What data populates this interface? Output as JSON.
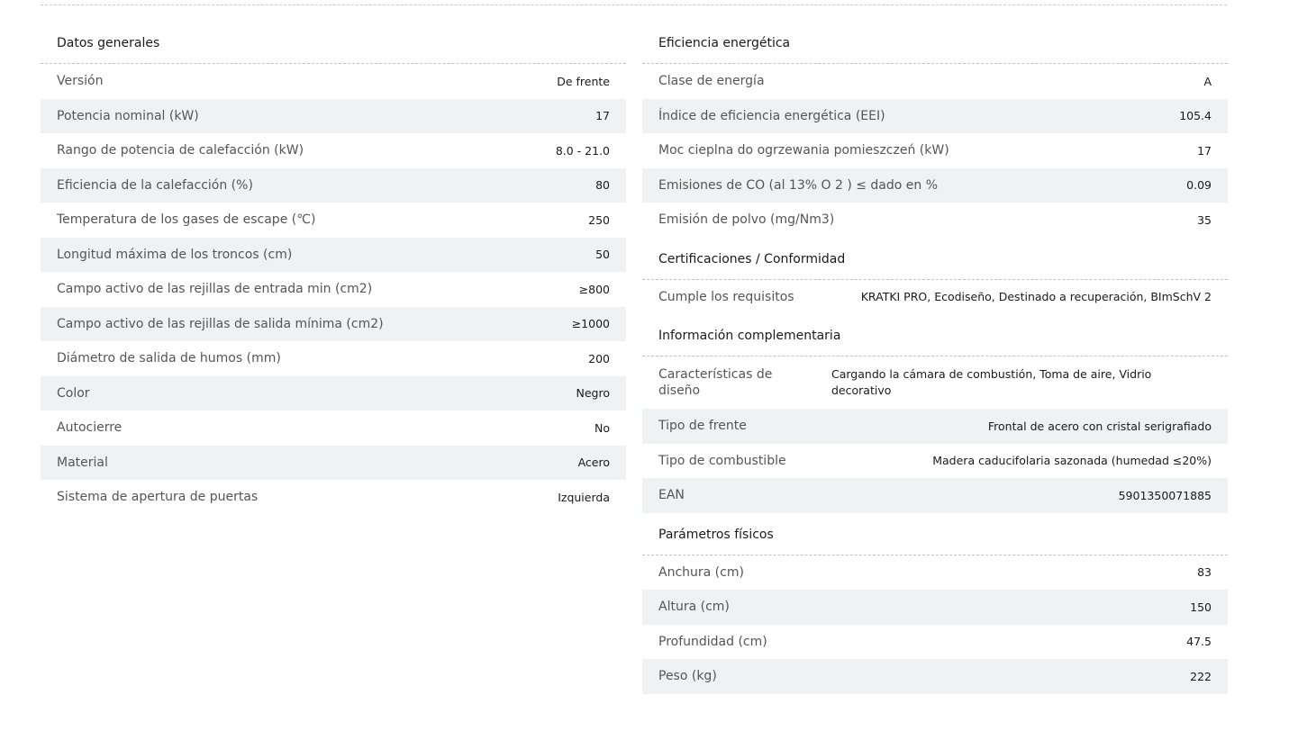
{
  "general": {
    "title": "Datos generales",
    "rows": [
      {
        "label": "Versión",
        "value": "De frente"
      },
      {
        "label": "Potencia nominal (kW)",
        "value": "17"
      },
      {
        "label": "Rango de potencia de calefacción (kW)",
        "value": "8.0 - 21.0"
      },
      {
        "label": "Eficiencia de la calefacción (%)",
        "value": "80"
      },
      {
        "label": "Temperatura de los gases de escape (℃)",
        "value": "250"
      },
      {
        "label": "Longitud máxima de los troncos (cm)",
        "value": "50"
      },
      {
        "label": "Campo activo de las rejillas de entrada min (cm2)",
        "value": "≥800"
      },
      {
        "label": "Campo activo de las rejillas de salida mínima (cm2)",
        "value": "≥1000"
      },
      {
        "label": "Diámetro de salida de humos (mm)",
        "value": "200"
      },
      {
        "label": "Color",
        "value": "Negro"
      },
      {
        "label": "Autocierre",
        "value": "No"
      },
      {
        "label": "Material",
        "value": "Acero"
      },
      {
        "label": "Sistema de apertura de puertas",
        "value": "Izquierda"
      }
    ]
  },
  "energy": {
    "title": "Eficiencia energética",
    "rows": [
      {
        "label": "Clase de energía",
        "value": "A"
      },
      {
        "label": "Índice de eficiencia energética (EEI)",
        "value": "105.4"
      },
      {
        "label": "Moc cieplna do ogrzewania pomieszczeń (kW)",
        "value": "17"
      },
      {
        "label": "Emisiones de CO (al 13% O 2 ) ≤ dado en %",
        "value": "0.09"
      },
      {
        "label": "Emisión de polvo (mg/Nm3)",
        "value": "35"
      }
    ]
  },
  "certs": {
    "title": "Certificaciones / Conformidad",
    "rows": [
      {
        "label": "Cumple los requisitos",
        "value": "KRATKI PRO, Ecodiseño, Destinado a recuperación, BImSchV 2"
      }
    ]
  },
  "extra": {
    "title": "Información complementaria",
    "rows": [
      {
        "label": "Características de diseño",
        "value": "Cargando la cámara de combustión, Toma de aire, Vidrio decorativo"
      },
      {
        "label": "Tipo de frente",
        "value": "Frontal de acero con cristal serigrafiado"
      },
      {
        "label": "Tipo de combustible",
        "value": "Madera caducifolaria sazonada (humedad ≤20%)"
      },
      {
        "label": "EAN",
        "value": "5901350071885"
      }
    ]
  },
  "physical": {
    "title": "Parámetros físicos",
    "rows": [
      {
        "label": "Anchura (cm)",
        "value": "83"
      },
      {
        "label": "Altura (cm)",
        "value": "150"
      },
      {
        "label": "Profundidad (cm)",
        "value": "47.5"
      },
      {
        "label": "Peso (kg)",
        "value": "222"
      }
    ]
  }
}
